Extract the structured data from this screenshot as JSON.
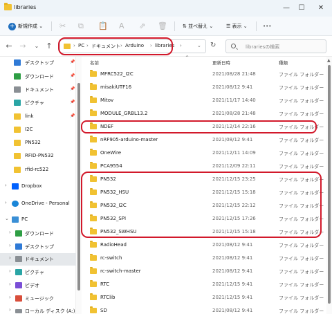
{
  "window": {
    "title": "libraries",
    "minimize": "—",
    "maximize": "☐",
    "close": "✕"
  },
  "commandbar": {
    "new_label": "新規作成",
    "new_dropdown": "⌄",
    "cut_icon": "✂",
    "copy_icon": "⧉",
    "paste_icon": "📋",
    "rename_icon": "A",
    "share_icon": "⇗",
    "delete_icon": "🗑",
    "sort_label": "並べ替え",
    "view_label": "表示",
    "more_label": "•••"
  },
  "addressbar": {
    "back": "←",
    "forward": "→",
    "recent": "⌄",
    "up": "↑",
    "crumbs": [
      "PC",
      "ドキュメント",
      "Arduino",
      "libraries"
    ],
    "sep": "›",
    "dropdown": "⌄",
    "refresh": "↻",
    "search_placeholder": "librariesの検索"
  },
  "sidebar": {
    "items": [
      {
        "label": "デスクトップ",
        "icon": "desktop-icon",
        "pinned": true
      },
      {
        "label": "ダウンロード",
        "icon": "download-icon",
        "pinned": true
      },
      {
        "label": "ドキュメント",
        "icon": "document-icon",
        "pinned": true
      },
      {
        "label": "ピクチャ",
        "icon": "picture-icon",
        "pinned": true
      },
      {
        "label": "link",
        "icon": "folder-icon",
        "pinned": true
      },
      {
        "label": "I2C",
        "icon": "folder-icon"
      },
      {
        "label": "PN532",
        "icon": "folder-icon"
      },
      {
        "label": "RFID-PN532",
        "icon": "folder-icon"
      },
      {
        "label": "rfid-rc522",
        "icon": "folder-icon"
      },
      {
        "label": "Dropbox",
        "icon": "dropbox-icon"
      },
      {
        "label": "OneDrive - Personal",
        "icon": "cloud-icon"
      },
      {
        "label": "PC",
        "icon": "pc-icon"
      },
      {
        "label": "ダウンロード",
        "icon": "download-icon"
      },
      {
        "label": "デスクトップ",
        "icon": "desktop-icon"
      },
      {
        "label": "ドキュメント",
        "icon": "document-icon",
        "selected": true
      },
      {
        "label": "ピクチャ",
        "icon": "picture-icon"
      },
      {
        "label": "ビデオ",
        "icon": "video-icon"
      },
      {
        "label": "ミュージック",
        "icon": "music-icon"
      },
      {
        "label": "ローカル ディスク (A:)",
        "icon": "drive-icon"
      }
    ],
    "pin_glyph": "📌",
    "expand_glyph": "›",
    "collapse_glyph": "⌄"
  },
  "filelist": {
    "columns": {
      "name": "名前",
      "date": "更新日時",
      "type": "種類"
    },
    "sort_indicator": "^",
    "rows": [
      {
        "name": "MFRC522_I2C",
        "date": "2021/08/28 21:48",
        "type": "ファイル フォルダー"
      },
      {
        "name": "misakiUTF16",
        "date": "2021/08/12 9:41",
        "type": "ファイル フォルダー"
      },
      {
        "name": "Mitov",
        "date": "2021/11/17 14:40",
        "type": "ファイル フォルダー"
      },
      {
        "name": "MODULE_GRBL13.2",
        "date": "2021/08/28 21:48",
        "type": "ファイル フォルダー"
      },
      {
        "name": "NDEF",
        "date": "2021/12/14 22:16",
        "type": "ファイル フォルダー"
      },
      {
        "name": "nRF905-arduino-master",
        "date": "2021/08/12 9:41",
        "type": "ファイル フォルダー"
      },
      {
        "name": "OneWire",
        "date": "2021/12/11 14:09",
        "type": "ファイル フォルダー"
      },
      {
        "name": "PCA9554",
        "date": "2021/12/09 22:11",
        "type": "ファイル フォルダー"
      },
      {
        "name": "PN532",
        "date": "2021/12/15 23:25",
        "type": "ファイル フォルダー"
      },
      {
        "name": "PN532_HSU",
        "date": "2021/12/15 15:18",
        "type": "ファイル フォルダー"
      },
      {
        "name": "PN532_I2C",
        "date": "2021/12/15 22:12",
        "type": "ファイル フォルダー"
      },
      {
        "name": "PN532_SPI",
        "date": "2021/12/15 17:26",
        "type": "ファイル フォルダー"
      },
      {
        "name": "PN532_SWHSU",
        "date": "2021/12/15 15:18",
        "type": "ファイル フォルダー"
      },
      {
        "name": "RadioHead",
        "date": "2021/08/12 9:41",
        "type": "ファイル フォルダー"
      },
      {
        "name": "rc-switch",
        "date": "2021/08/12 9:41",
        "type": "ファイル フォルダー"
      },
      {
        "name": "rc-switch-master",
        "date": "2021/08/12 9:41",
        "type": "ファイル フォルダー"
      },
      {
        "name": "RTC",
        "date": "2021/12/15 9:41",
        "type": "ファイル フォルダー"
      },
      {
        "name": "RTClib",
        "date": "2021/12/15 9:41",
        "type": "ファイル フォルダー"
      },
      {
        "name": "SD",
        "date": "2021/08/12 9:41",
        "type": "ファイル フォルダー"
      }
    ]
  },
  "annotation_color": "#d2192b"
}
